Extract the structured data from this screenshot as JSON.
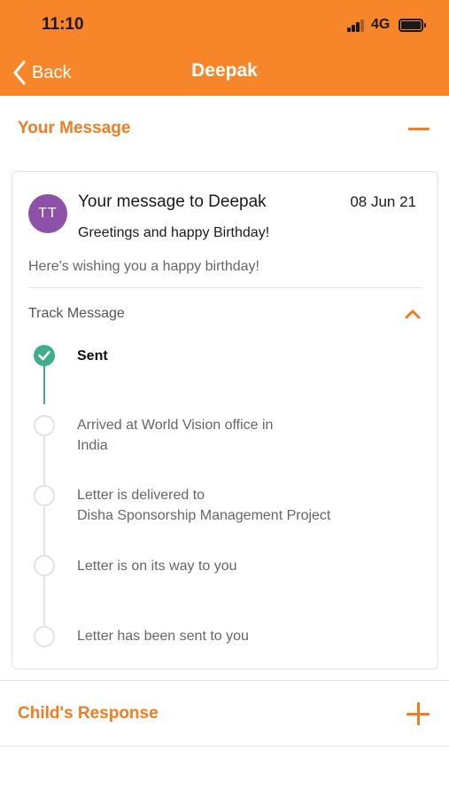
{
  "status_bar": {
    "time": "11:10",
    "network": "4G"
  },
  "nav": {
    "back_label": "Back",
    "title": "Deepak"
  },
  "your_message_section": {
    "title": "Your Message",
    "expanded": true,
    "message": {
      "avatar_initials": "TT",
      "avatar_color": "#8D52A8",
      "to": "Your message to Deepak",
      "date": "08 Jun 21",
      "subject": "Greetings and happy Birthday!",
      "body": "Here's wishing you a happy birthday!"
    },
    "track": {
      "label": "Track Message",
      "expanded": true,
      "steps": [
        {
          "line1": "Sent",
          "line2": "",
          "done": true
        },
        {
          "line1": "Arrived at World Vision office in",
          "line2": "India",
          "done": false
        },
        {
          "line1": "Letter is delivered to",
          "line2": "Disha Sponsorship Management Project",
          "done": false
        },
        {
          "line1": "Letter is on its way to you",
          "line2": "",
          "done": false
        },
        {
          "line1": "Letter has been sent to you",
          "line2": "",
          "done": false
        }
      ]
    }
  },
  "childs_response_section": {
    "title": "Child's Response",
    "expanded": false
  },
  "colors": {
    "accent": "#F7862A",
    "accent_text": "#F07D22",
    "success": "#3FAE88",
    "avatar": "#8D52A8"
  }
}
